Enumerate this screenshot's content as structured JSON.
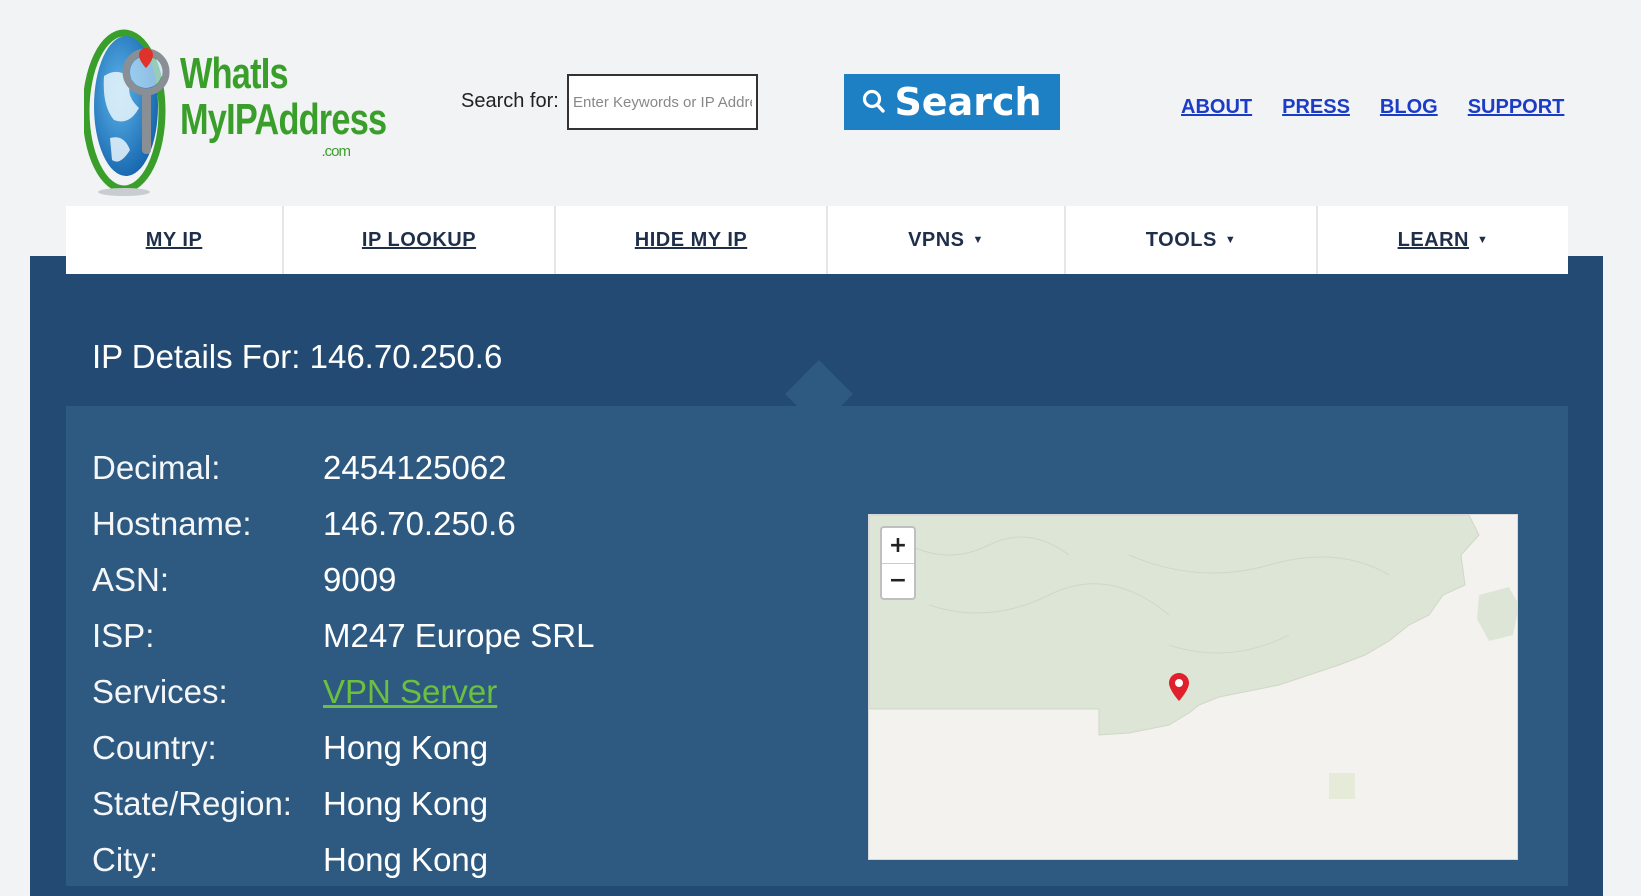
{
  "header": {
    "logo": {
      "line1": "WhatIs",
      "line2": "MyIPAddress",
      "line3": ".com",
      "color": "#3a9f2a",
      "globe_color": "#1d7fc4"
    },
    "search": {
      "label": "Search for:",
      "placeholder": "Enter Keywords or IP Address",
      "button_label": "Search",
      "button_color": "#1d7fc4"
    },
    "links": [
      "ABOUT",
      "PRESS",
      "BLOG",
      "SUPPORT"
    ]
  },
  "nav": {
    "items": [
      {
        "label": "MY IP",
        "dropdown": false
      },
      {
        "label": "IP LOOKUP",
        "dropdown": false
      },
      {
        "label": "HIDE MY IP",
        "dropdown": false
      },
      {
        "label": "VPNS",
        "dropdown": true
      },
      {
        "label": "TOOLS",
        "dropdown": true
      },
      {
        "label": "LEARN",
        "dropdown": true
      }
    ]
  },
  "main": {
    "title": "IP Details For: 146.70.250.6",
    "details": [
      {
        "label": "Decimal:",
        "value": "2454125062"
      },
      {
        "label": "Hostname:",
        "value": "146.70.250.6"
      },
      {
        "label": "ASN:",
        "value": "9009"
      },
      {
        "label": "ISP:",
        "value": "M247 Europe SRL"
      },
      {
        "label": "Services:",
        "value": "VPN Server"
      },
      {
        "label": "Country:",
        "value": "Hong Kong"
      },
      {
        "label": "State/Region:",
        "value": "Hong Kong"
      },
      {
        "label": "City:",
        "value": "Hong Kong"
      }
    ],
    "map": {
      "zoom_in": "+",
      "zoom_out": "−"
    }
  },
  "colors": {
    "panel_bg": "#224a72",
    "details_bg": "#2e5a82",
    "link_green": "#6cc040",
    "top_link": "#1b3cc6"
  }
}
